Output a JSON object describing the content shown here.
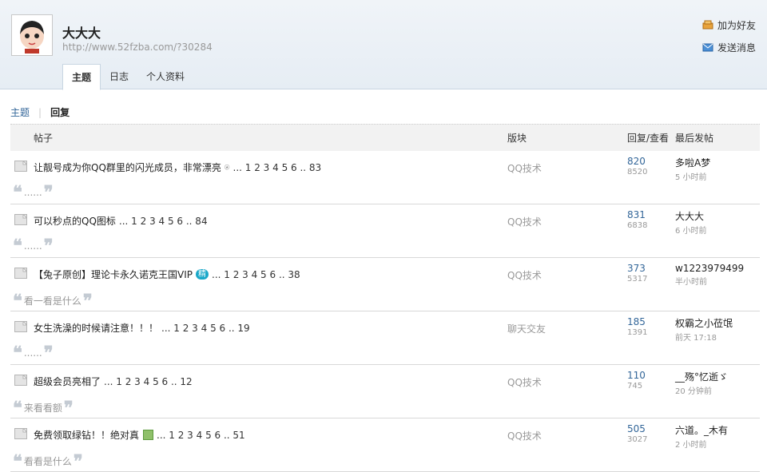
{
  "profile": {
    "name": "大大大",
    "url": "http://www.52fzba.com/?30284"
  },
  "actions": [
    {
      "label": "加为好友",
      "icon": "add-friend-icon"
    },
    {
      "label": "发送消息",
      "icon": "message-icon"
    }
  ],
  "tabs": [
    {
      "label": "主题",
      "active": true
    },
    {
      "label": "日志",
      "active": false
    },
    {
      "label": "个人资料",
      "active": false
    }
  ],
  "subnav": {
    "topics": "主题",
    "replies": "回复"
  },
  "table": {
    "headers": {
      "post": "帖子",
      "forum": "版块",
      "stats": "回复/查看",
      "last": "最后发帖"
    },
    "rows": [
      {
        "subject": "让靓号成为你QQ群里的闪光成员，非常漂亮",
        "has_clip": true,
        "has_badge": false,
        "has_image": false,
        "pages": "... 1 2 3 4 5 6 .. 83",
        "forum": "QQ技术",
        "replies": "820",
        "views": "8520",
        "last_user": "多啦A梦",
        "last_time": "5 小时前",
        "quote": "......"
      },
      {
        "subject": "可以秒点的QQ图标",
        "has_clip": false,
        "has_badge": false,
        "has_image": false,
        "pages": "... 1 2 3 4 5 6 .. 84",
        "forum": "QQ技术",
        "replies": "831",
        "views": "6838",
        "last_user": "大大大",
        "last_time": "6 小时前",
        "quote": "......"
      },
      {
        "subject": "【兔子原创】理论卡永久诺克王国VIP",
        "has_clip": false,
        "has_badge": true,
        "badge": "精",
        "has_image": false,
        "pages": "... 1 2 3 4 5 6 .. 38",
        "forum": "QQ技术",
        "replies": "373",
        "views": "5317",
        "last_user": "w1223979499",
        "last_time": "半小时前",
        "quote": "看一看是什么"
      },
      {
        "subject": "女生洗澡的时候请注意！！！",
        "has_clip": false,
        "has_badge": false,
        "has_image": false,
        "pages": "... 1 2 3 4 5 6 .. 19",
        "forum": "聊天交友",
        "replies": "185",
        "views": "1391",
        "last_user": "权霸之小莅氓",
        "last_time": "前天 17:18",
        "quote": "......"
      },
      {
        "subject": "超级会员亮相了",
        "has_clip": false,
        "has_badge": false,
        "has_image": false,
        "pages": "... 1 2 3 4 5 6 .. 12",
        "forum": "QQ技术",
        "replies": "110",
        "views": "745",
        "last_user": "__殇°忆逝ゞ",
        "last_time": "20 分钟前",
        "quote": "来看看额"
      },
      {
        "subject": "免费领取绿钻！！绝对真",
        "has_clip": false,
        "has_badge": false,
        "has_image": true,
        "pages": "... 1 2 3 4 5 6 .. 51",
        "forum": "QQ技术",
        "replies": "505",
        "views": "3027",
        "last_user": "六道。_木有",
        "last_time": "2 小时前",
        "quote": "看看是什么"
      }
    ]
  }
}
